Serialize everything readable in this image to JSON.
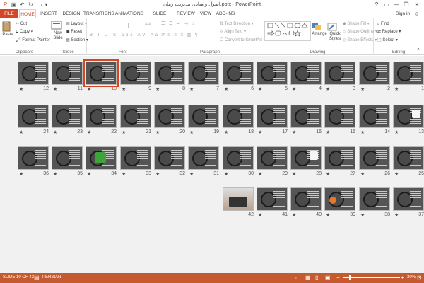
{
  "window": {
    "title": "اصول و مبادی مدیریت زمان.pptx - PowerPoint",
    "minimize_icon": "minimize-icon",
    "restore_icon": "restore-icon",
    "close_icon": "close-icon",
    "help_label": "?"
  },
  "tabs": [
    "FILE",
    "HOME",
    "INSERT",
    "DESIGN",
    "TRANSITIONS",
    "ANIMATIONS",
    "SLIDE SHOW",
    "REVIEW",
    "VIEW",
    "ADD-INS"
  ],
  "active_tab": "HOME",
  "sign_in": "Sign in",
  "ribbon": {
    "clipboard": {
      "label": "Clipboard",
      "paste": "Paste",
      "cut": "Cut",
      "copy": "Copy",
      "format_painter": "Format Painter"
    },
    "slides": {
      "label": "Slides",
      "new_slide": "New Slide",
      "layout": "Layout",
      "reset": "Reset",
      "section": "Section"
    },
    "font": {
      "label": "Font"
    },
    "paragraph": {
      "label": "Paragraph",
      "text_direction": "Text Direction",
      "align_text": "Align Text",
      "convert_smartart": "Convert to SmartArt"
    },
    "drawing": {
      "label": "Drawing",
      "arrange": "Arrange",
      "quick_styles": "Quick Styles",
      "shape_fill": "Shape Fill",
      "shape_outline": "Shape Outline",
      "shape_effects": "Shape Effects",
      "shapes_glyphs": "▭\\ ⬡⬭△◻\n⇨⬨⤷{}☆"
    },
    "editing": {
      "label": "Editing",
      "find": "Find",
      "replace": "Replace",
      "select": "Select"
    }
  },
  "slides": [
    {
      "n": "1",
      "kind": "lines"
    },
    {
      "n": "2",
      "kind": "clock"
    },
    {
      "n": "3",
      "kind": "clock"
    },
    {
      "n": "4",
      "kind": "clock"
    },
    {
      "n": "5",
      "kind": "clock"
    },
    {
      "n": "6",
      "kind": "clock"
    },
    {
      "n": "7",
      "kind": "clock"
    },
    {
      "n": "8",
      "kind": "clock"
    },
    {
      "n": "9",
      "kind": "clock"
    },
    {
      "n": "10",
      "kind": "clock",
      "selected": true
    },
    {
      "n": "11",
      "kind": "clock"
    },
    {
      "n": "12",
      "kind": "clock"
    },
    {
      "n": "13",
      "kind": "white"
    },
    {
      "n": "14",
      "kind": "clock"
    },
    {
      "n": "15",
      "kind": "clock"
    },
    {
      "n": "16",
      "kind": "clock"
    },
    {
      "n": "17",
      "kind": "clock"
    },
    {
      "n": "18",
      "kind": "clock"
    },
    {
      "n": "19",
      "kind": "clock"
    },
    {
      "n": "20",
      "kind": "clock"
    },
    {
      "n": "21",
      "kind": "clock"
    },
    {
      "n": "22",
      "kind": "clock"
    },
    {
      "n": "23",
      "kind": "clock"
    },
    {
      "n": "24",
      "kind": "clock"
    },
    {
      "n": "25",
      "kind": "clock"
    },
    {
      "n": "26",
      "kind": "clock"
    },
    {
      "n": "27",
      "kind": "clock"
    },
    {
      "n": "28",
      "kind": "white"
    },
    {
      "n": "29",
      "kind": "clock"
    },
    {
      "n": "30",
      "kind": "lines"
    },
    {
      "n": "31",
      "kind": "clock"
    },
    {
      "n": "32",
      "kind": "clock"
    },
    {
      "n": "33",
      "kind": "clock"
    },
    {
      "n": "34",
      "kind": "flower"
    },
    {
      "n": "35",
      "kind": "clock"
    },
    {
      "n": "36",
      "kind": "clock"
    },
    {
      "n": "37",
      "kind": "clock"
    },
    {
      "n": "38",
      "kind": "clock"
    },
    {
      "n": "39",
      "kind": "orange"
    },
    {
      "n": "40",
      "kind": "clock"
    },
    {
      "n": "41",
      "kind": "clock"
    },
    {
      "n": "42",
      "kind": "photo"
    }
  ],
  "status": {
    "slide_info": "SLIDE 10 OF 42",
    "language": "PERSIAN",
    "zoom": "30%",
    "zoom_level_percent": 30
  },
  "colors": {
    "accent": "#d24726",
    "statusbar": "#c55a2f"
  }
}
